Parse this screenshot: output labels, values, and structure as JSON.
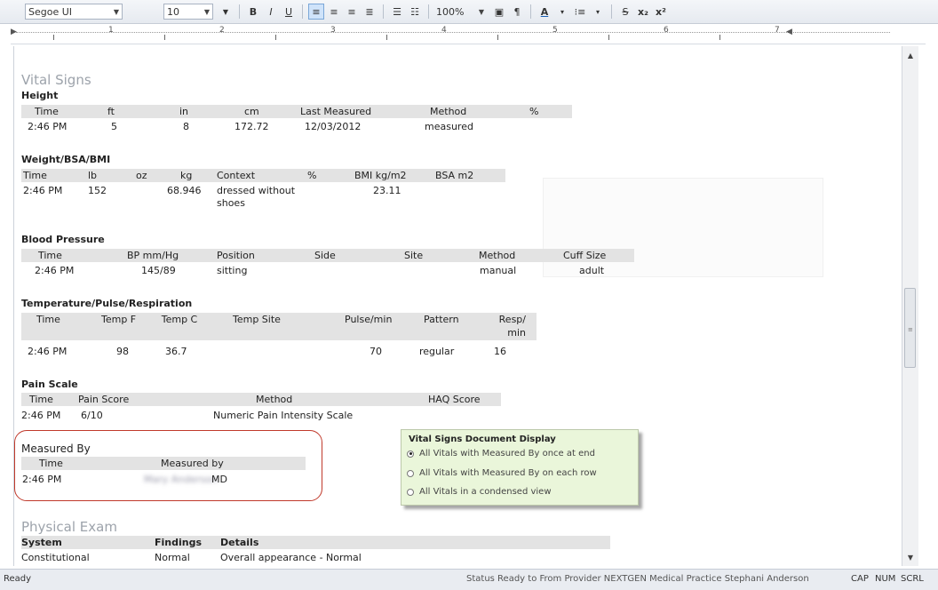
{
  "toolbar": {
    "font_name": "Segoe UI",
    "font_size": "10",
    "bold": "B",
    "italic": "I",
    "underline": "U",
    "zoom": "100%",
    "pilcrow": "¶",
    "font_color": "A",
    "strike": "S",
    "subscript": "x₂",
    "superscript": "x²"
  },
  "ruler": {
    "numbers": [
      "1",
      "2",
      "3",
      "4",
      "5",
      "6",
      "7"
    ]
  },
  "vitals": {
    "title": "Vital Signs",
    "height": {
      "title": "Height",
      "headers": [
        "Time",
        "ft",
        "in",
        "cm",
        "Last Measured",
        "Method",
        "%"
      ],
      "row": [
        "2:46 PM",
        "5",
        "8",
        "172.72",
        "12/03/2012",
        "measured",
        ""
      ]
    },
    "weight": {
      "title": "Weight/BSA/BMI",
      "headers": [
        "Time",
        "lb",
        "oz",
        "kg",
        "Context",
        "%",
        "BMI kg/m2",
        "BSA m2"
      ],
      "row": [
        "2:46 PM",
        "152",
        "",
        "68.946",
        "dressed without shoes",
        "",
        "23.11",
        ""
      ]
    },
    "bp": {
      "title": "Blood Pressure",
      "headers": [
        "Time",
        "BP mm/Hg",
        "Position",
        "Side",
        "Site",
        "Method",
        "Cuff Size"
      ],
      "row": [
        "2:46 PM",
        "145/89",
        "sitting",
        "",
        "",
        "manual",
        "adult"
      ]
    },
    "tpr": {
      "title": "Temperature/Pulse/Respiration",
      "headers": [
        "Time",
        "Temp F",
        "Temp C",
        "Temp Site",
        "Pulse/min",
        "Pattern",
        "Resp/ min"
      ],
      "row": [
        "2:46 PM",
        "98",
        "36.7",
        "",
        "70",
        "regular",
        "16"
      ]
    },
    "pain": {
      "title": "Pain Scale",
      "headers": [
        "Time",
        "Pain Score",
        "Method",
        "HAQ Score"
      ],
      "row": [
        "2:46 PM",
        "6/10",
        "Numeric Pain Intensity Scale",
        ""
      ]
    },
    "measured": {
      "title": "Measured By",
      "headers": [
        "Time",
        "Measured by"
      ],
      "row_time": "2:46 PM",
      "row_name_blurred": "Mary Anderson",
      "row_suffix": "MD"
    }
  },
  "physical": {
    "title": "Physical Exam",
    "headers": [
      "System",
      "Findings",
      "Details"
    ],
    "row": [
      "Constitutional",
      "Normal",
      "Overall appearance - Normal"
    ]
  },
  "tooltip": {
    "title": "Vital Signs Document Display",
    "options": [
      "All Vitals with Measured By once at end",
      "All Vitals with Measured By on each row",
      "All Vitals in a condensed view"
    ],
    "selected": 0
  },
  "status": {
    "left": "Ready",
    "right": "Status Ready to From Provider NEXTGEN Medical Practice Stephani Anderson",
    "caps": "CAP",
    "num": "NUM",
    "scrl": "SCRL"
  }
}
